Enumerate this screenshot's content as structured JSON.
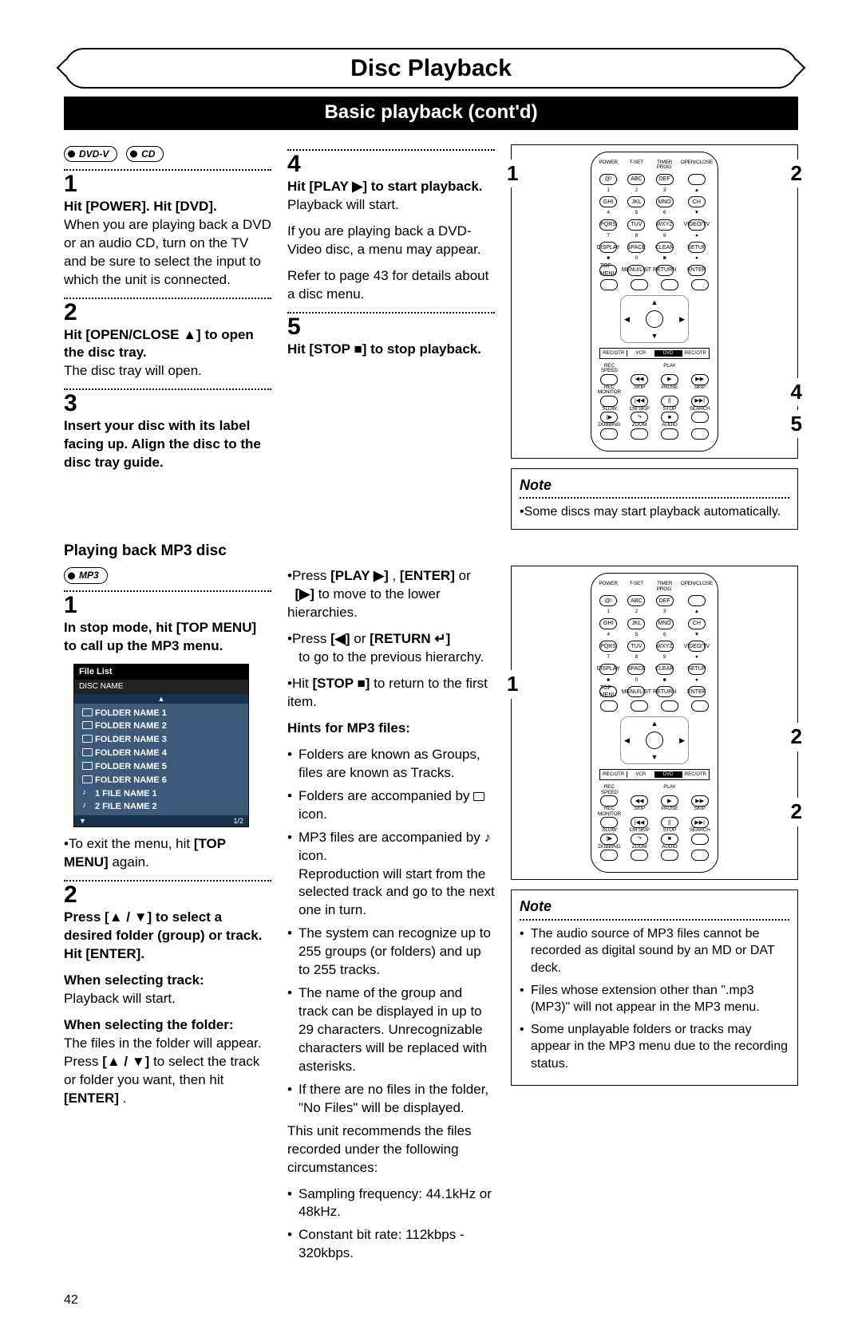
{
  "header": {
    "title": "Disc Playback",
    "subtitle": "Basic playback (cont'd)"
  },
  "badges": {
    "dvd": "DVD-V",
    "cd": "CD",
    "mp3": "MP3"
  },
  "basic": {
    "s1_head": "Hit [POWER]. Hit [DVD].",
    "s1_body": "When you are playing back a DVD or an audio CD, turn on the TV and be sure to select the input to which the unit is connected.",
    "s2_head": "Hit [OPEN/CLOSE ▲] to open the disc tray.",
    "s2_body": "The disc tray will open.",
    "s3_head": "Insert your disc with its label facing up. Align the disc to the disc tray guide.",
    "s4_head": "Hit [PLAY ▶] to start playback.",
    "s4_b1": "Playback will start.",
    "s4_b2": "If you are playing back a DVD-Video disc, a menu may appear.",
    "s4_b3": "Refer to page 43 for details about a disc menu.",
    "s5_head": "Hit [STOP ■] to stop playback."
  },
  "mp3": {
    "heading": "Playing back MP3 disc",
    "s1_head": "In stop mode, hit [TOP MENU] to call up the MP3 menu.",
    "fl": {
      "title": "File List",
      "sub": "DISC NAME",
      "rows": [
        {
          "t": "f",
          "n": "FOLDER NAME 1"
        },
        {
          "t": "f",
          "n": "FOLDER NAME 2"
        },
        {
          "t": "f",
          "n": "FOLDER NAME 3"
        },
        {
          "t": "f",
          "n": "FOLDER NAME 4"
        },
        {
          "t": "f",
          "n": "FOLDER NAME 5"
        },
        {
          "t": "f",
          "n": "FOLDER NAME 6"
        },
        {
          "t": "t",
          "n": "1  FILE NAME 1"
        },
        {
          "t": "t",
          "n": "2  FILE NAME 2"
        }
      ],
      "page": "1/2"
    },
    "s1_exit1": "•To exit the menu, hit ",
    "s1_exit2": "[TOP MENU]",
    "s1_exit3": " again.",
    "s2_head": "Press [▲ / ▼] to select a desired folder (group) or track. Hit [ENTER].",
    "sel_track_h": "When selecting track:",
    "sel_track_b": "Playback will start.",
    "sel_folder_h": "When selecting the folder:",
    "sel_folder_b1": "The files in the folder will appear. Press ",
    "sel_folder_b2": "[▲ / ▼]",
    "sel_folder_b3": " to select the track or folder you want, then hit ",
    "sel_folder_b4": "[ENTER]",
    "sel_folder_b5": ".",
    "nav1a": "•Press ",
    "nav1b": "[PLAY ▶]",
    "nav1c": ", ",
    "nav1d": "[ENTER]",
    "nav1e": " or ",
    "nav1f": "[▶]",
    "nav1g": " to move to the lower hierarchies.",
    "nav2a": "•Press ",
    "nav2b": "[◀]",
    "nav2c": " or ",
    "nav2d": "[RETURN ↵]",
    "nav2e": " to go to the previous hierarchy.",
    "nav3a": "•Hit ",
    "nav3b": "[STOP ■]",
    "nav3c": " to return to the first item.",
    "hints_h": "Hints for MP3 files:",
    "h1": "Folders are known as Groups, files are known as Tracks.",
    "h2": "Folders are accompanied by",
    "h2b": "icon.",
    "h3": "MP3 files are accompanied by ♪ icon.",
    "h3b": "Reproduction will start from the selected track and go to the next one in turn.",
    "h4": "The system can recognize up to 255 groups (or folders) and up to 255 tracks.",
    "h5": "The name of the group and track can be displayed in up to 29 characters. Unrecognizable characters will be replaced with asterisks.",
    "h6": "If there are no files in the folder, \"No Files\" will be displayed.",
    "rec_intro": "This unit recommends the files recorded under the following circumstances:",
    "rec1": "Sampling frequency: 44.1kHz or 48kHz.",
    "rec2": "Constant bit rate: 112kbps - 320kbps."
  },
  "notes": {
    "title": "Note",
    "n1": "Some discs may start playback automatically.",
    "m1": "The audio source of MP3 files cannot be recorded as digital sound by an MD or DAT deck.",
    "m2": "Files whose extension other than \".mp3 (MP3)\" will not appear in the MP3 menu.",
    "m3": "Some unplayable folders or tracks may appear in the MP3 menu due to the recording status."
  },
  "remote": {
    "cols": [
      "POWER",
      "T-SET",
      "TIMER PROG.",
      "OPEN/CLOSE",
      "@!",
      "ABC",
      "DEF",
      "",
      "1",
      "2",
      "3",
      "▲",
      "GHI",
      "JKL",
      "MNO",
      "CH",
      "4",
      "5",
      "6",
      "▼",
      "PQRS",
      "TUV",
      "WXYZ",
      "VIDEO/TV",
      "7",
      "8",
      "9",
      "●",
      "DISPLAY",
      "SPACE",
      "CLEAR",
      "SETUP",
      "■",
      "0",
      "■",
      "●",
      "TOP MENU",
      "MENU/LIST",
      "RETURN",
      "ENTER"
    ],
    "modes": [
      "REC/OTR",
      "VCR",
      "DVD",
      "REC/OTR"
    ],
    "row2lbl": [
      "REC SPEED",
      "",
      "PLAY",
      ""
    ],
    "row2btn": [
      "",
      "◀◀",
      "▶",
      "▶▶"
    ],
    "row3lbl": [
      "REC MONITOR",
      "SKIP",
      "PAUSE",
      "SKIP"
    ],
    "row3btn": [
      "",
      "|◀◀",
      "||",
      "▶▶|"
    ],
    "row4lbl": [
      "SLOW",
      "CM SKIP",
      "STOP",
      "SEARCH"
    ],
    "row4btn": [
      "|▶",
      "↷",
      "■",
      ""
    ],
    "row5lbl": [
      "DUBBING",
      "ZOOM",
      "AUDIO",
      ""
    ],
    "row5btn": [
      "",
      "",
      "",
      ""
    ]
  },
  "callouts": {
    "r1": {
      "a": "1",
      "b": "2",
      "c": "4",
      "d": "5"
    },
    "r2": {
      "a": "1",
      "b": "2",
      "c": "2"
    }
  },
  "page": "42"
}
